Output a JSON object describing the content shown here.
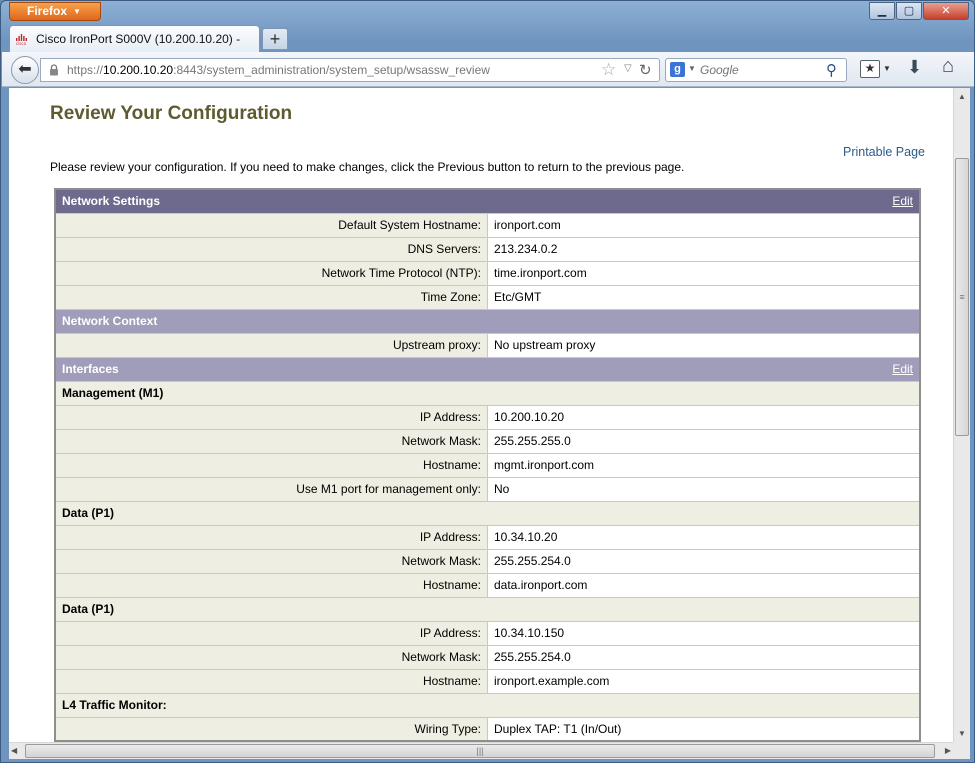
{
  "browser": {
    "app_button": "Firefox",
    "tab_title": "Cisco IronPort S000V (10.200.10.20) -",
    "new_tab": "+",
    "url_prefix": "https://",
    "url_host": "10.200.10.20",
    "url_path": ":8443/system_administration/system_setup/wsassw_review",
    "search_placeholder": "Google",
    "search_engine_letter": "g"
  },
  "page": {
    "title": "Review Your Configuration",
    "printable_link": "Printable Page",
    "intro": "Please review your configuration. If you need to make changes, click the Previous button to return to the previous page."
  },
  "network_settings": {
    "header": "Network Settings",
    "edit": "Edit",
    "rows": [
      {
        "label": "Default System Hostname:",
        "value": "ironport.com"
      },
      {
        "label": "DNS Servers:",
        "value": "213.234.0.2"
      },
      {
        "label": "Network Time Protocol (NTP):",
        "value": "time.ironport.com"
      },
      {
        "label": "Time Zone:",
        "value": "Etc/GMT"
      }
    ]
  },
  "network_context": {
    "header": "Network Context",
    "rows": [
      {
        "label": "Upstream proxy:",
        "value": "No upstream proxy"
      }
    ]
  },
  "interfaces": {
    "header": "Interfaces",
    "edit": "Edit",
    "management": {
      "title": "Management (M1)",
      "rows": [
        {
          "label": "IP Address:",
          "value": "10.200.10.20"
        },
        {
          "label": "Network Mask:",
          "value": "255.255.255.0"
        },
        {
          "label": "Hostname:",
          "value": "mgmt.ironport.com"
        },
        {
          "label": "Use M1 port for management only:",
          "value": "No"
        }
      ]
    },
    "data1": {
      "title": "Data (P1)",
      "rows": [
        {
          "label": "IP Address:",
          "value": "10.34.10.20"
        },
        {
          "label": "Network Mask:",
          "value": "255.255.254.0"
        },
        {
          "label": "Hostname:",
          "value": "data.ironport.com"
        }
      ]
    },
    "data2": {
      "title": "Data (P1)",
      "rows": [
        {
          "label": "IP Address:",
          "value": "10.34.10.150"
        },
        {
          "label": "Network Mask:",
          "value": "255.255.254.0"
        },
        {
          "label": "Hostname:",
          "value": "ironport.example.com"
        }
      ]
    },
    "l4": {
      "title": "L4 Traffic Monitor:",
      "rows": [
        {
          "label": "Wiring Type:",
          "value": "Duplex TAP: T1 (In/Out)"
        }
      ]
    }
  }
}
